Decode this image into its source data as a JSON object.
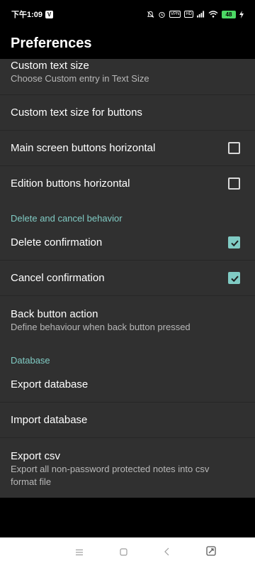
{
  "status": {
    "time": "下午1:09",
    "app_badge": "V",
    "vpn": "VPN",
    "net": "HD",
    "battery": "48"
  },
  "header": {
    "title": "Preferences"
  },
  "rows": {
    "custom_text_size": {
      "title": "Custom text size",
      "summary": "Choose Custom entry in Text Size"
    },
    "custom_text_size_buttons": {
      "title": "Custom text size for buttons"
    },
    "main_buttons_horizontal": {
      "title": "Main screen buttons horizontal",
      "checked": false
    },
    "edition_buttons_horizontal": {
      "title": "Edition buttons horizontal",
      "checked": false
    },
    "section_delete": "Delete and cancel behavior",
    "delete_confirmation": {
      "title": "Delete confirmation",
      "checked": true
    },
    "cancel_confirmation": {
      "title": "Cancel confirmation",
      "checked": true
    },
    "back_button_action": {
      "title": "Back button action",
      "summary": "Define behaviour when back button pressed"
    },
    "section_database": "Database",
    "export_database": {
      "title": "Export database"
    },
    "import_database": {
      "title": "Import database"
    },
    "export_csv": {
      "title": "Export csv",
      "summary": "Export all non-password protected notes into csv format file"
    }
  },
  "colors": {
    "accent": "#80cbc4",
    "background": "#303030",
    "toolbar": "#000000"
  },
  "icons": [
    "mute-icon",
    "alarm-icon",
    "wifi-icon",
    "signal-icon",
    "charging-icon",
    "menu-icon",
    "home-icon",
    "back-icon",
    "recents-icon"
  ]
}
